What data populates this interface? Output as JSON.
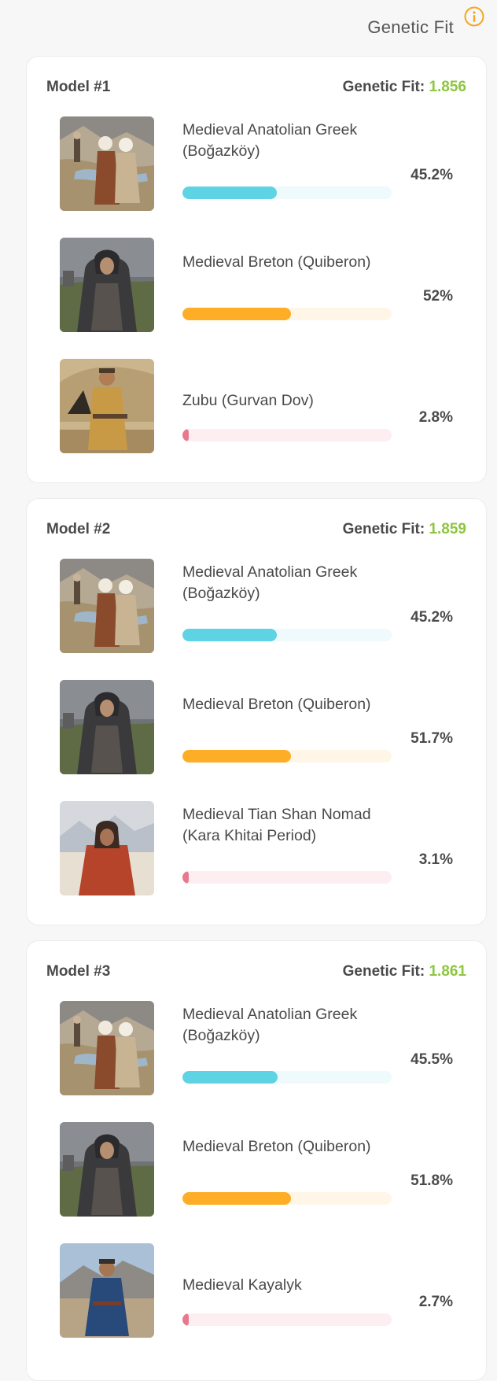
{
  "header": {
    "title": "Genetic Fit"
  },
  "colors": {
    "fit_value": "#8dc63f",
    "teal_fill": "#5ed3e3",
    "teal_track": "#eefafc",
    "orange_fill": "#fdae26",
    "orange_track": "#fff6e8",
    "pink_fill": "#e9788f",
    "pink_track": "#fdeef1",
    "info_icon": "#f5a623"
  },
  "fit_label": "Genetic Fit: ",
  "models": [
    {
      "label": "Model #1",
      "fit": "1.856",
      "rows": [
        {
          "name": "Medieval Anatolian Greek (Boğazköy)",
          "pct": "45.2%",
          "value": 45.2,
          "color": "teal",
          "image": "women-by-stream-illustration"
        },
        {
          "name": "Medieval Breton (Quiberon)",
          "pct": "52%",
          "value": 52,
          "color": "orange",
          "image": "hooded-monk-illustration"
        },
        {
          "name": "Zubu (Gurvan Dov)",
          "pct": "2.8%",
          "value": 2.8,
          "color": "pink",
          "image": "nomad-by-yurt-illustration"
        }
      ]
    },
    {
      "label": "Model #2",
      "fit": "1.859",
      "rows": [
        {
          "name": "Medieval Anatolian Greek (Boğazköy)",
          "pct": "45.2%",
          "value": 45.2,
          "color": "teal",
          "image": "women-by-stream-illustration"
        },
        {
          "name": "Medieval Breton (Quiberon)",
          "pct": "51.7%",
          "value": 51.7,
          "color": "orange",
          "image": "hooded-monk-illustration"
        },
        {
          "name": "Medieval Tian Shan Nomad (Kara Khitai Period)",
          "pct": "3.1%",
          "value": 3.1,
          "color": "pink",
          "image": "nomad-in-red-coat-illustration"
        }
      ]
    },
    {
      "label": "Model #3",
      "fit": "1.861",
      "rows": [
        {
          "name": "Medieval Anatolian Greek (Boğazköy)",
          "pct": "45.5%",
          "value": 45.5,
          "color": "teal",
          "image": "women-by-stream-illustration"
        },
        {
          "name": "Medieval Breton (Quiberon)",
          "pct": "51.8%",
          "value": 51.8,
          "color": "orange",
          "image": "hooded-monk-illustration"
        },
        {
          "name": "Medieval Kayalyk",
          "pct": "2.7%",
          "value": 2.7,
          "color": "pink",
          "image": "nomad-in-blue-coat-illustration"
        }
      ]
    }
  ]
}
